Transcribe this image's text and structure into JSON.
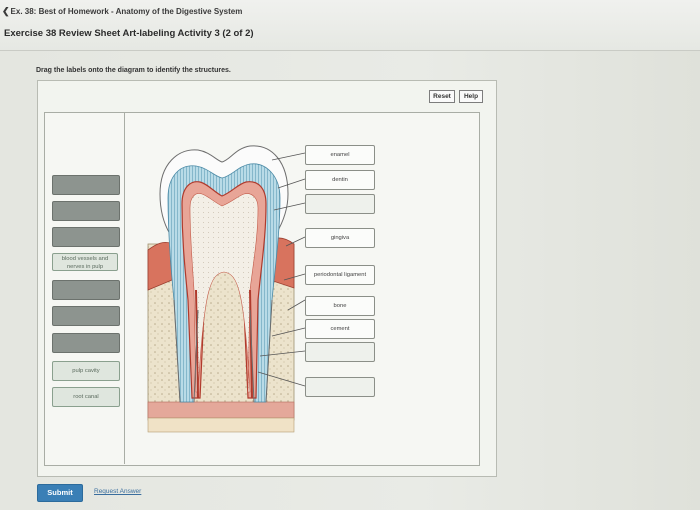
{
  "header": {
    "back_link": "Ex. 38: Best of Homework - Anatomy of the Digestive System",
    "title": "Exercise 38 Review Sheet Art-labeling Activity 3 (2 of 2)"
  },
  "instruction": "Drag the labels onto the diagram to identify the structures.",
  "toolbar": {
    "reset": "Reset",
    "help": "Help"
  },
  "label_bank": [
    {
      "state": "empty"
    },
    {
      "state": "empty"
    },
    {
      "state": "empty"
    },
    {
      "state": "label",
      "text": "blood vessels and nerves in pulp"
    },
    {
      "state": "empty"
    },
    {
      "state": "empty"
    },
    {
      "state": "empty"
    },
    {
      "state": "label",
      "text": "pulp cavity"
    },
    {
      "state": "label",
      "text": "root canal"
    }
  ],
  "drop_targets": [
    {
      "text": "enamel"
    },
    {
      "text": "dentin"
    },
    {
      "text": ""
    },
    {
      "text": "gingiva"
    },
    {
      "text": "periodontal ligament"
    },
    {
      "text": "bone"
    },
    {
      "text": "cement"
    },
    {
      "text": ""
    },
    {
      "text": ""
    }
  ],
  "footer": {
    "submit": "Submit",
    "request_answer": "Request Answer"
  }
}
